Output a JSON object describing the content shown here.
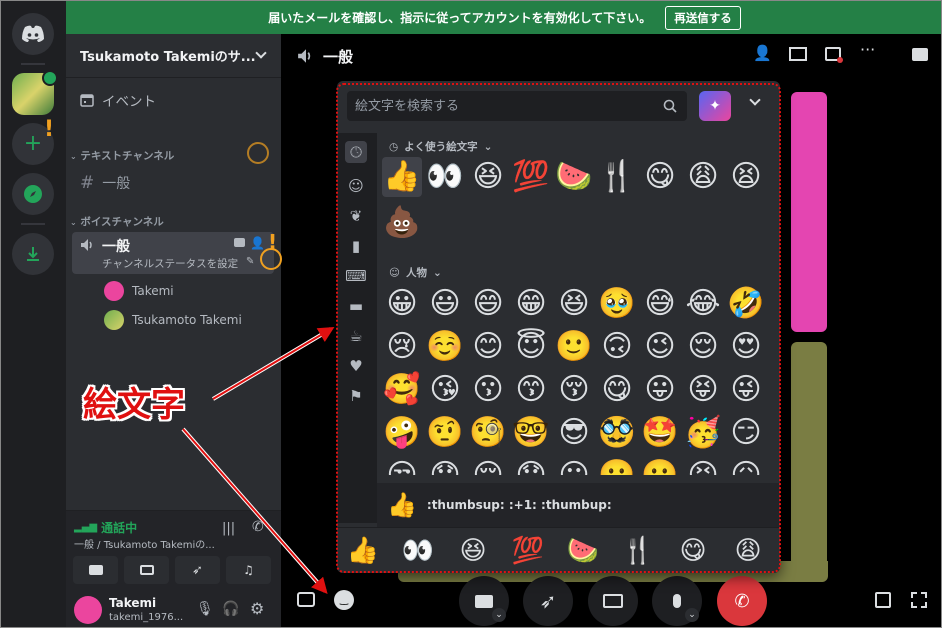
{
  "banner": {
    "message": "届いたメールを確認し、指示に従ってアカウントを有効化して下さい。",
    "resend_label": "再送信する"
  },
  "server": {
    "name": "Tsukamoto Takemiのサ..."
  },
  "sidebar": {
    "events_label": "イベント",
    "text_category": "テキストチャンネル",
    "text_channel": "一般",
    "voice_category": "ボイスチャンネル",
    "voice_channel": "一般",
    "voice_status": "チャンネルステータスを設定",
    "members": [
      "Takemi",
      "Tsukamoto Takemi"
    ]
  },
  "call": {
    "status": "通話中",
    "location": "一般 / Tsukamoto Takemiの..."
  },
  "user": {
    "name": "Takemi",
    "tag": "takemi_1976..."
  },
  "main": {
    "channel_title": "一般"
  },
  "picker": {
    "search_placeholder": "絵文字を検索する",
    "frequent_title": "よく使う絵文字",
    "people_title": "人物",
    "frequent": [
      "👍",
      "👀",
      "😆",
      "💯",
      "🍉",
      "🍴",
      "😋",
      "😩",
      "😫",
      "💩"
    ],
    "people": [
      "😀",
      "😃",
      "😄",
      "😁",
      "😆",
      "🥹",
      "😅",
      "😂",
      "🤣",
      "😢",
      "☺️",
      "😊",
      "😇",
      "🙂",
      "🙃",
      "😉",
      "😌",
      "😍",
      "🥰",
      "😘",
      "😗",
      "😙",
      "😚",
      "😋",
      "😛",
      "😝",
      "😜",
      "🤪",
      "🤨",
      "🧐",
      "🤓",
      "😎",
      "🥸",
      "🤩",
      "🥳",
      "😏",
      "😒",
      "😞",
      "😔",
      "😟",
      "😕",
      "🙁",
      "☹️",
      "😣",
      "😖"
    ],
    "preview_emoji": "👍",
    "preview_text": ":thumbsup: :+1: :thumbup:",
    "favorites": [
      "👍",
      "👀",
      "😆",
      "💯",
      "🍉",
      "🍴",
      "😋",
      "😩"
    ]
  },
  "annotation": {
    "label": "絵文字"
  },
  "colors": {
    "accent_red": "#e01010",
    "banner_green": "#248046",
    "hangup_red": "#da373c"
  }
}
